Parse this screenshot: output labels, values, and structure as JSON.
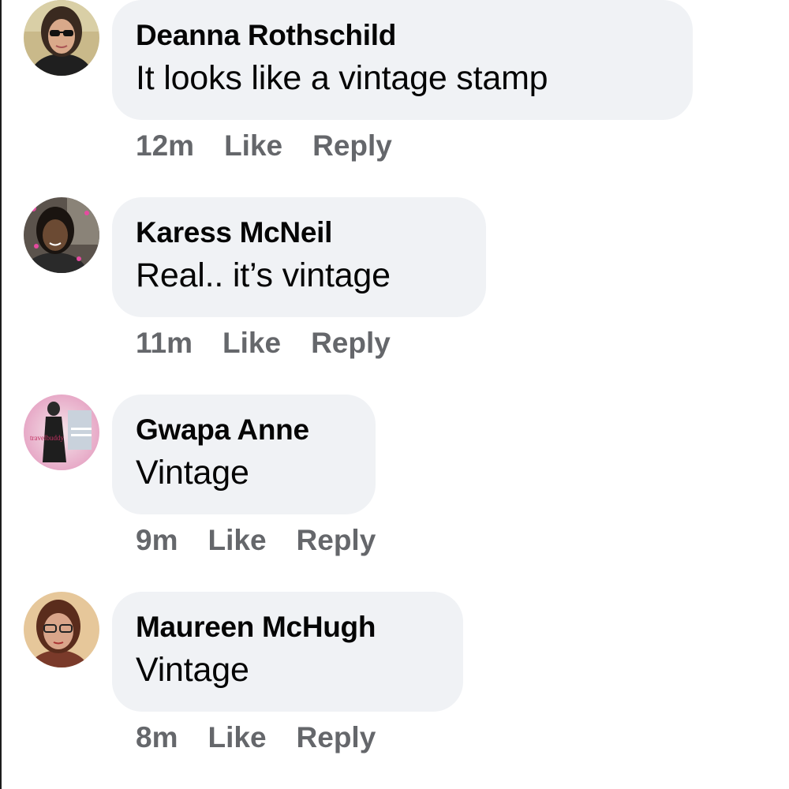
{
  "comments": [
    {
      "author": "Deanna Rothschild",
      "text": "It looks like a vintage stamp",
      "time": "12m",
      "like_label": "Like",
      "reply_label": "Reply"
    },
    {
      "author": "Karess McNeil",
      "text": "Real.. it’s vintage",
      "time": "11m",
      "like_label": "Like",
      "reply_label": "Reply"
    },
    {
      "author": "Gwapa Anne",
      "text": "Vintage",
      "time": "9m",
      "like_label": "Like",
      "reply_label": "Reply"
    },
    {
      "author": "Maureen McHugh",
      "text": "Vintage",
      "time": "8m",
      "like_label": "Like",
      "reply_label": "Reply"
    }
  ],
  "colors": {
    "bubble_bg": "#f0f2f5",
    "name_text": "#050505",
    "meta_text": "#65676b"
  }
}
